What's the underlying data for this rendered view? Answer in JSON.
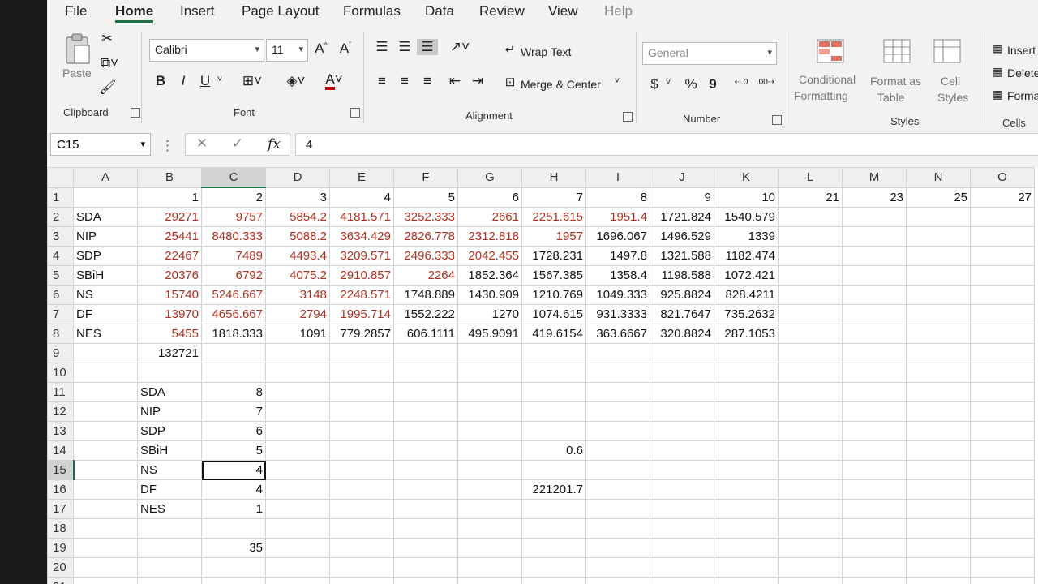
{
  "menu": [
    "File",
    "Home",
    "Insert",
    "Page Layout",
    "Formulas",
    "Data",
    "Review",
    "View",
    "Help"
  ],
  "ribbon": {
    "clipboard": {
      "paste_label": "Paste",
      "group_label": "Clipboard"
    },
    "font": {
      "name": "Calibri",
      "size": "11",
      "group_label": "Font",
      "bold": "B",
      "italic": "I",
      "underline": "U",
      "grow": "A^",
      "shrink": "Aˇ"
    },
    "alignment": {
      "wrap_text": "Wrap Text",
      "merge_center": "Merge & Center",
      "group_label": "Alignment"
    },
    "number": {
      "format": "General",
      "currency": "$",
      "percent": "%",
      "comma": "9",
      "group_label": "Number"
    },
    "styles": {
      "conditional": "Conditional",
      "formatting": "Formatting",
      "format_as": "Format as",
      "table": "Table",
      "cell": "Cell",
      "styles": "Styles",
      "group_label": "Styles"
    },
    "cells": {
      "insert": "Insert",
      "delete": "Delete",
      "format": "Forma",
      "group_label": "Cells"
    }
  },
  "formula_bar": {
    "name_box": "C15",
    "formula": "4",
    "fx_label": "fx"
  },
  "columns": [
    "A",
    "B",
    "C",
    "D",
    "E",
    "F",
    "G",
    "H",
    "I",
    "J",
    "K",
    "L",
    "M",
    "N",
    "O"
  ],
  "selected_col": "C",
  "selected_row": "15",
  "rows": [
    {
      "n": "1",
      "cells": [
        "",
        "1",
        "2",
        "3",
        "4",
        "5",
        "6",
        "7",
        "8",
        "9",
        "10",
        "21",
        "23",
        "25",
        "27"
      ]
    },
    {
      "n": "2",
      "cells": [
        "SDA",
        "29271",
        "9757",
        "5854.2",
        "4181.571",
        "3252.333",
        "2661",
        "2251.615",
        "1951.4",
        "1721.824",
        "1540.579",
        "",
        "",
        "",
        ""
      ]
    },
    {
      "n": "3",
      "cells": [
        "NIP",
        "25441",
        "8480.333",
        "5088.2",
        "3634.429",
        "2826.778",
        "2312.818",
        "1957",
        "1696.067",
        "1496.529",
        "1339",
        "",
        "",
        "",
        ""
      ]
    },
    {
      "n": "4",
      "cells": [
        "SDP",
        "22467",
        "7489",
        "4493.4",
        "3209.571",
        "2496.333",
        "2042.455",
        "1728.231",
        "1497.8",
        "1321.588",
        "1182.474",
        "",
        "",
        "",
        ""
      ]
    },
    {
      "n": "5",
      "cells": [
        "SBiH",
        "20376",
        "6792",
        "4075.2",
        "2910.857",
        "2264",
        "1852.364",
        "1567.385",
        "1358.4",
        "1198.588",
        "1072.421",
        "",
        "",
        "",
        ""
      ]
    },
    {
      "n": "6",
      "cells": [
        "NS",
        "15740",
        "5246.667",
        "3148",
        "2248.571",
        "1748.889",
        "1430.909",
        "1210.769",
        "1049.333",
        "925.8824",
        "828.4211",
        "",
        "",
        "",
        ""
      ]
    },
    {
      "n": "7",
      "cells": [
        "DF",
        "13970",
        "4656.667",
        "2794",
        "1995.714",
        "1552.222",
        "1270",
        "1074.615",
        "931.3333",
        "821.7647",
        "735.2632",
        "",
        "",
        "",
        ""
      ]
    },
    {
      "n": "8",
      "cells": [
        "NES",
        "5455",
        "1818.333",
        "1091",
        "779.2857",
        "606.1111",
        "495.9091",
        "419.6154",
        "363.6667",
        "320.8824",
        "287.1053",
        "",
        "",
        "",
        ""
      ]
    },
    {
      "n": "9",
      "cells": [
        "",
        "132721",
        "",
        "",
        "",
        "",
        "",
        "",
        "",
        "",
        "",
        "",
        "",
        "",
        ""
      ]
    },
    {
      "n": "10",
      "cells": [
        "",
        "",
        "",
        "",
        "",
        "",
        "",
        "",
        "",
        "",
        "",
        "",
        "",
        "",
        ""
      ]
    },
    {
      "n": "11",
      "cells": [
        "",
        "SDA",
        "8",
        "",
        "",
        "",
        "",
        "",
        "",
        "",
        "",
        "",
        "",
        "",
        ""
      ]
    },
    {
      "n": "12",
      "cells": [
        "",
        "NIP",
        "7",
        "",
        "",
        "",
        "",
        "",
        "",
        "",
        "",
        "",
        "",
        "",
        ""
      ]
    },
    {
      "n": "13",
      "cells": [
        "",
        "SDP",
        "6",
        "",
        "",
        "",
        "",
        "",
        "",
        "",
        "",
        "",
        "",
        "",
        ""
      ]
    },
    {
      "n": "14",
      "cells": [
        "",
        "SBiH",
        "5",
        "",
        "",
        "",
        "",
        "0.6",
        "",
        "",
        "",
        "",
        "",
        "",
        ""
      ]
    },
    {
      "n": "15",
      "cells": [
        "",
        "NS",
        "4",
        "",
        "",
        "",
        "",
        "",
        "",
        "",
        "",
        "",
        "",
        "",
        ""
      ]
    },
    {
      "n": "16",
      "cells": [
        "",
        "DF",
        "4",
        "",
        "",
        "",
        "",
        "221201.7",
        "",
        "",
        "",
        "",
        "",
        "",
        ""
      ]
    },
    {
      "n": "17",
      "cells": [
        "",
        "NES",
        "1",
        "",
        "",
        "",
        "",
        "",
        "",
        "",
        "",
        "",
        "",
        "",
        ""
      ]
    },
    {
      "n": "18",
      "cells": [
        "",
        "",
        "",
        "",
        "",
        "",
        "",
        "",
        "",
        "",
        "",
        "",
        "",
        "",
        ""
      ]
    },
    {
      "n": "19",
      "cells": [
        "",
        "",
        "35",
        "",
        "",
        "",
        "",
        "",
        "",
        "",
        "",
        "",
        "",
        "",
        ""
      ]
    },
    {
      "n": "20",
      "cells": [
        "",
        "",
        "",
        "",
        "",
        "",
        "",
        "",
        "",
        "",
        "",
        "",
        "",
        "",
        ""
      ]
    },
    {
      "n": "21",
      "cells": [
        "",
        "",
        "",
        "",
        "",
        "",
        "",
        "",
        "",
        "",
        "",
        "",
        "",
        "",
        ""
      ]
    }
  ],
  "red_cells": [
    "2-1",
    "2-2",
    "2-3",
    "2-4",
    "2-5",
    "2-6",
    "2-7",
    "2-8",
    "3-1",
    "3-2",
    "3-3",
    "3-4",
    "3-5",
    "3-6",
    "3-7",
    "4-1",
    "4-2",
    "4-3",
    "4-4",
    "4-5",
    "4-6",
    "5-1",
    "5-2",
    "5-3",
    "5-4",
    "5-5",
    "6-1",
    "6-2",
    "6-3",
    "6-4",
    "7-1",
    "7-2",
    "7-3",
    "7-4",
    "8-1"
  ],
  "text_cols": [
    0
  ],
  "text_cells_b": [
    "11",
    "12",
    "13",
    "14",
    "15",
    "16",
    "17"
  ],
  "colors": {
    "accent": "#1e7145",
    "red_text": "#b03020"
  }
}
